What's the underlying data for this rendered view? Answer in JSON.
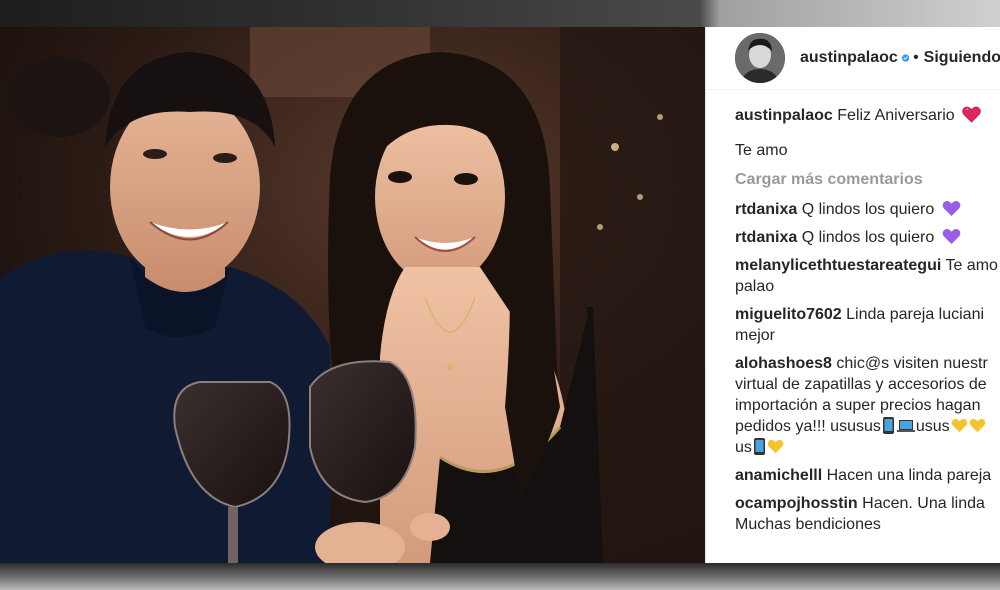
{
  "post": {
    "author": "austinpalaoc",
    "follow_status": "Siguiendo",
    "separator": "•",
    "caption": {
      "user": "austinpalaoc",
      "text": "Feliz Aniversario",
      "emoji": "red-heart-icon"
    },
    "caption_line2": "Te amo"
  },
  "load_more_label": "Cargar más comentarios",
  "comments": [
    {
      "user": "rtdanixa",
      "text": "Q lindos los quiero",
      "emoji": "purple-heart-icon"
    },
    {
      "user": "rtdanixa",
      "text": "Q lindos los quiero",
      "emoji": "purple-heart-icon"
    },
    {
      "user": "melanylicethtuestareategui",
      "text": "Te amo",
      "line2": "palao"
    },
    {
      "user": "miguelito7602",
      "text": "Linda pareja luciani",
      "line2": "mejor"
    },
    {
      "user": "alohashoes8",
      "text": "chic@s visiten nuestr",
      "line2": "virtual de zapatillas y accesorios de",
      "line3": "importación a super precios hagan",
      "line4": "pedidos ya!!! ususus",
      "line4b": "usus",
      "line5": "us"
    },
    {
      "user": "anamichelll",
      "text": "Hacen una linda pareja"
    },
    {
      "user": "ocampojhosstin",
      "text": "Hacen. Una linda",
      "line2": "Muchas bendiciones"
    }
  ],
  "colors": {
    "text": "#262626",
    "muted": "#999999",
    "verified": "#3897f0",
    "red_heart": "#e0245e",
    "purple_heart": "#9b5de5",
    "yellow_heart": "#f4c430"
  }
}
